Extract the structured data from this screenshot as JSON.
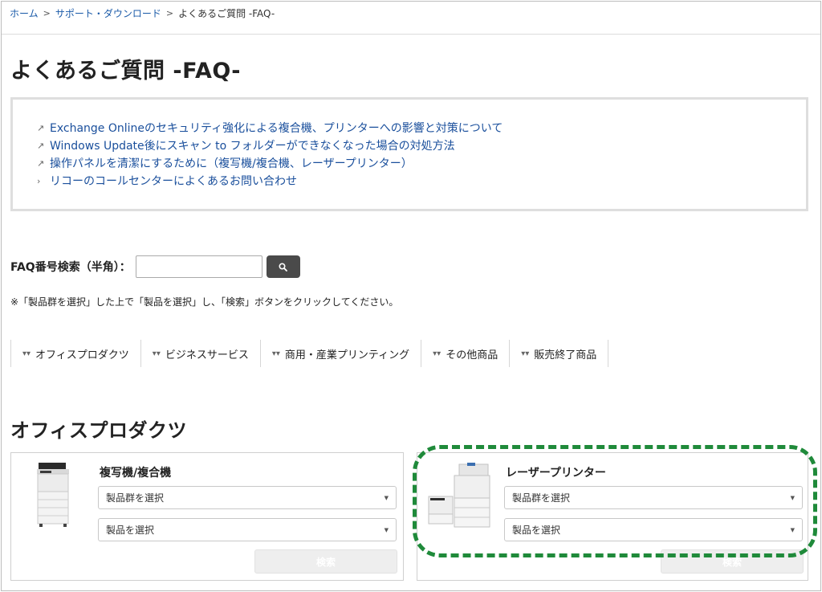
{
  "breadcrumb": {
    "home": "ホーム",
    "sep": ">",
    "support": "サポート・ダウンロード",
    "current": "よくあるご質問 -FAQ-"
  },
  "page_title": "よくあるご質問 -FAQ-",
  "notices": [
    {
      "icon": "external-link-icon",
      "text": "Exchange Onlineのセキュリティ強化による複合機、プリンターへの影響と対策について"
    },
    {
      "icon": "external-link-icon",
      "text": "Windows Update後にスキャン to フォルダーができなくなった場合の対処方法"
    },
    {
      "icon": "external-link-icon",
      "text": "操作パネルを清潔にするために（複写機/複合機、レーザープリンター）"
    },
    {
      "icon": "chevron-right-icon",
      "text": "リコーのコールセンターによくあるお問い合わせ"
    }
  ],
  "faq_search": {
    "label": "FAQ番号検索（半角）：",
    "value": "",
    "button_icon": "search-icon"
  },
  "note": "※「製品群を選択」した上で「製品を選択」し、「検索」ボタンをクリックしてください。",
  "categories": [
    {
      "label": "オフィスプロダクツ"
    },
    {
      "label": "ビジネスサービス"
    },
    {
      "label": "商用・産業プリンティング"
    },
    {
      "label": "その他商品"
    },
    {
      "label": "販売終了商品"
    }
  ],
  "section_title": "オフィスプロダクツ",
  "cards": [
    {
      "title": "複写機/複合機",
      "group_select": "製品群を選択",
      "product_select": "製品を選択",
      "search_button": "検索"
    },
    {
      "title": "レーザープリンター",
      "group_select": "製品群を選択",
      "product_select": "製品を選択",
      "search_button": "検索"
    }
  ],
  "colors": {
    "link": "#1a4f9c",
    "highlight": "#1f8a3a",
    "search_button_bg": "#4a4a4a"
  }
}
